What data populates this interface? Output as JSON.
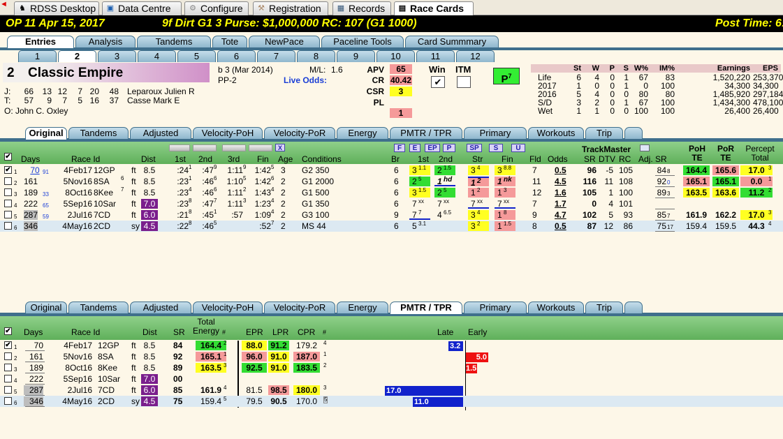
{
  "app": {
    "tabs": [
      {
        "label": "RDSS Desktop",
        "icon": "horse-icon"
      },
      {
        "label": "Data Centre",
        "icon": "folder-icon"
      },
      {
        "label": "Configure",
        "icon": "gear-icon"
      },
      {
        "label": "Registration",
        "icon": "wrench-icon"
      },
      {
        "label": "Records",
        "icon": "grid-icon"
      },
      {
        "label": "Race Cards",
        "icon": "document-icon"
      }
    ]
  },
  "race": {
    "track": "OP 11 Apr 15, 2017",
    "conditions": "9f Dirt G1 3 Purse: $1,000,000 RC: 107 (G1 1000)",
    "post": "Post Time: 6:"
  },
  "view_tabs": [
    "Entries",
    "Analysis",
    "Tandems",
    "Tote",
    "NewPace",
    "Paceline Tools",
    "Card Summmary"
  ],
  "entry_tabs": [
    "1",
    "2",
    "3",
    "4",
    "5",
    "6",
    "7",
    "8",
    "9",
    "10",
    "11",
    "12"
  ],
  "horse": {
    "number": "2",
    "name": "Classic Empire",
    "breeding": "b 3 (Mar 2014)",
    "pp": "PP-2",
    "ml_label": "M/L:",
    "ml": "1.6",
    "live_odds": "Live Odds:",
    "jockey": {
      "label": "J:",
      "stats": [
        "66",
        "13",
        "12",
        "7",
        "20",
        "48"
      ],
      "name": "Leparoux Julien R"
    },
    "trainer": {
      "label": "T:",
      "stats": [
        "57",
        "9",
        "7",
        "5",
        "16",
        "37"
      ],
      "name": "Casse Mark E"
    },
    "owner": {
      "label": "O:",
      "name": "John C. Oxley"
    }
  },
  "ratings": {
    "apv_label": "APV",
    "apv": "65",
    "cr_label": "CR",
    "cr": "40.42",
    "csr_label": "CSR",
    "csr": "3",
    "pl_label": "PL",
    "pl": "",
    "rank": "1",
    "win_label": "Win",
    "itm_label": "ITM",
    "p_badge": "P",
    "p_sup": "7"
  },
  "career": {
    "headers": [
      "St",
      "W",
      "P",
      "S",
      "W%",
      "IM%",
      "Earnings",
      "EPS"
    ],
    "rows": [
      [
        "Life",
        "6",
        "4",
        "0",
        "1",
        "67",
        "83",
        "1,520,220",
        "253,370"
      ],
      [
        "2017",
        "1",
        "0",
        "0",
        "1",
        "0",
        "100",
        "34,300",
        "34,300"
      ],
      [
        "2016",
        "5",
        "4",
        "0",
        "0",
        "80",
        "80",
        "1,485,920",
        "297,184"
      ],
      [
        "S/D",
        "3",
        "2",
        "0",
        "1",
        "67",
        "100",
        "1,434,300",
        "478,100"
      ],
      [
        "Wet",
        "1",
        "1",
        "0",
        "0",
        "100",
        "100",
        "26,400",
        "26,400"
      ]
    ]
  },
  "sub_tabs": [
    "Original",
    "Tandems",
    "Adjusted",
    "Velocity-PoH",
    "Velocity-PoR",
    "Energy",
    "PMTR / TPR",
    "Primary",
    "Workouts",
    "Trip"
  ],
  "top_table": {
    "headers": [
      "Days",
      "Race Id",
      "Dist",
      "1st",
      "2nd",
      "3rd",
      "Fin",
      "Age",
      "Conditions",
      "Br",
      "1st",
      "2nd",
      "Str",
      "Fin",
      "Fld",
      "Odds",
      "SR",
      "DTV",
      "RC",
      "Adj. SR",
      "PoH TE",
      "PoR TE",
      "Percept Total"
    ],
    "trackmaster": "TrackMaster",
    "pace_btns": [
      "F",
      "E",
      "EP",
      "P"
    ],
    "sp_btns": [
      "SP",
      "S",
      "U"
    ],
    "x_btn": "X",
    "rows": [
      {
        "n": "1",
        "checked": true,
        "days": "70",
        "ds": "7",
        "dsub": "91",
        "race": "4Feb17",
        "rs": "",
        "rt": "12GP",
        "surf": "ft",
        "dist": "8.5",
        "dc": "",
        "c1": ":24",
        "s1": "1",
        "c2": ":47",
        "s2": "9",
        "c3": "1:11",
        "s3": "9",
        "fin": "1:42",
        "s4": "5",
        "age": "3",
        "cond": "G2 350",
        "br": "6",
        "p1": "3",
        "q1": "1.1",
        "p2": "2",
        "q2": "1.5",
        "st": "3",
        "qs": "4",
        "fn": "3",
        "qf": "8.8",
        "fld": "7",
        "odds": "0.5",
        "sr": "96",
        "dtv": "-5",
        "rc": "105",
        "adj": "84",
        "as": "8",
        "poh": "164.4",
        "por": "165.6",
        "pt": "17.0",
        "ps": "3"
      },
      {
        "n": "2",
        "checked": false,
        "days": "161",
        "ds": "",
        "dsub": "",
        "race": "5Nov16",
        "rs": "6",
        "rt": "8SA",
        "surf": "ft",
        "dist": "8.5",
        "dc": "",
        "c1": ":23",
        "s1": "1",
        "c2": ":46",
        "s2": "6",
        "c3": "1:10",
        "s3": "5",
        "fin": "1:42",
        "s4": "6",
        "age": "2",
        "cond": "G1 2000",
        "br": "6",
        "p1": "2",
        "q1": "5",
        "p2": "1",
        "q2": "hd",
        "st": "1",
        "qs": "2",
        "fn": "1",
        "qf": "nk",
        "fld": "11",
        "odds": "4.5",
        "sr": "116",
        "dtv": "11",
        "rc": "108",
        "adj": "92",
        "as": "0",
        "poh": "165.1",
        "por": "165.1",
        "pt": "0.0",
        "ps": "1"
      },
      {
        "n": "3",
        "checked": false,
        "days": "189",
        "ds": "",
        "dsub": "33",
        "race": "8Oct16",
        "rs": "7",
        "rt": "8Kee",
        "surf": "ft",
        "dist": "8.5",
        "dc": "",
        "c1": ":23",
        "s1": "4",
        "c2": ":46",
        "s2": "6",
        "c3": "1:11",
        "s3": "2",
        "fin": "1:43",
        "s4": "4",
        "age": "2",
        "cond": "G1 500",
        "br": "6",
        "p1": "3",
        "q1": "1.5",
        "p2": "2",
        "q2": "5",
        "st": "1",
        "qs": "2",
        "fn": "1",
        "qf": "3",
        "fld": "12",
        "odds": "1.6",
        "sr": "105",
        "dtv": "1",
        "rc": "100",
        "adj": "89",
        "as": "3",
        "poh": "163.5",
        "por": "163.6",
        "pt": "11.2",
        "ps": "2"
      },
      {
        "n": "4",
        "checked": false,
        "days": "222",
        "ds": "",
        "dsub": "65",
        "race": "5Sep16",
        "rs": "",
        "rt": "10Sar",
        "surf": "ft",
        "dist": "7.0",
        "dc": "purple",
        "c1": ":23",
        "s1": "8",
        "c2": ":47",
        "s2": "7",
        "c3": "1:11",
        "s3": "3",
        "fin": "1:23",
        "s4": "4",
        "age": "2",
        "cond": "G1 350",
        "br": "6",
        "p1": "7",
        "q1": "xx",
        "p2": "7",
        "q2": "xx",
        "st": "7",
        "qs": "xx",
        "fn": "7",
        "qf": "xx",
        "fld": "7",
        "odds": "1.7",
        "sr": "0",
        "dtv": "4",
        "rc": "101",
        "adj": "",
        "as": "",
        "poh": "",
        "por": "",
        "pt": "",
        "ps": ""
      },
      {
        "n": "5",
        "checked": false,
        "days": "287",
        "ds": "",
        "dsub": "59",
        "race": "2Jul16",
        "rs": "",
        "rt": "7CD",
        "surf": "ft",
        "dist": "6.0",
        "dc": "purple",
        "c1": ":21",
        "s1": "8",
        "c2": ":45",
        "s2": "1",
        "c3": ":57",
        "s3": "",
        "fin": "1:09",
        "s4": "4",
        "age": "2",
        "cond": "G3 100",
        "br": "9",
        "p1": "7",
        "q1": "7",
        "p2": "4",
        "q2": "6.5",
        "st": "3",
        "qs": "4",
        "fn": "1",
        "qf": "8",
        "fld": "9",
        "odds": "4.7",
        "sr": "102",
        "dtv": "5",
        "rc": "93",
        "adj": "85",
        "as": "7",
        "poh": "161.9",
        "por": "162.2",
        "pt": "17.0",
        "ps": "3"
      },
      {
        "n": "6",
        "checked": false,
        "days": "346",
        "ds": "",
        "dsub": "",
        "race": "4May16",
        "rs": "",
        "rt": "2CD",
        "surf": "sy",
        "dist": "4.5",
        "dc": "purple",
        "c1": ":22",
        "s1": "8",
        "c2": ":46",
        "s2": "5",
        "c3": "",
        "s3": "",
        "fin": ":52",
        "s4": "7",
        "age": "2",
        "cond": "MS 44",
        "br": "6",
        "p1": "5",
        "q1": "3.1",
        "p2": "",
        "q2": "",
        "st": "3",
        "qs": "2",
        "fn": "1",
        "qf": "1.5",
        "fld": "8",
        "odds": "0.5",
        "sr": "87",
        "dtv": "12",
        "rc": "86",
        "adj": "75",
        "as": "17",
        "poh": "159.4",
        "por": "159.5",
        "pt": "44.3",
        "ps": "4"
      }
    ]
  },
  "bottom_table": {
    "headers": [
      "Days",
      "Race Id",
      "Dist",
      "SR",
      "Total Energy",
      "#",
      "EPR",
      "LPR",
      "CPR",
      "#",
      "Late",
      "Early"
    ],
    "rows": [
      {
        "n": "1",
        "checked": true,
        "days": "70",
        "race": "4Feb17",
        "rt": "12GP",
        "surf": "ft",
        "dist": "8.5",
        "sr": "84",
        "te": "164.4",
        "tes": "2",
        "epr": "88.0",
        "lpr": "91.2",
        "cpr": "179.2",
        "cs": "4",
        "late": "3.2",
        "early": ""
      },
      {
        "n": "2",
        "checked": false,
        "days": "161",
        "race": "5Nov16",
        "rt": "8SA",
        "surf": "ft",
        "dist": "8.5",
        "sr": "92",
        "te": "165.1",
        "tes": "1",
        "epr": "96.0",
        "lpr": "91.0",
        "cpr": "187.0",
        "cs": "1",
        "late": "",
        "early": "5.0"
      },
      {
        "n": "3",
        "checked": false,
        "days": "189",
        "race": "8Oct16",
        "rt": "8Kee",
        "surf": "ft",
        "dist": "8.5",
        "sr": "89",
        "te": "163.5",
        "tes": "3",
        "epr": "92.5",
        "lpr": "91.0",
        "cpr": "183.5",
        "cs": "2",
        "late": "",
        "early": "1.5"
      },
      {
        "n": "4",
        "checked": false,
        "days": "222",
        "race": "5Sep16",
        "rt": "10Sar",
        "surf": "ft",
        "dist": "7.0",
        "sr": "00",
        "te": "",
        "tes": "",
        "epr": "",
        "lpr": "",
        "cpr": "",
        "cs": "",
        "late": "",
        "early": ""
      },
      {
        "n": "5",
        "checked": false,
        "days": "287",
        "race": "2Jul16",
        "rt": "7CD",
        "surf": "ft",
        "dist": "6.0",
        "sr": "85",
        "te": "161.9",
        "tes": "4",
        "epr": "81.5",
        "lpr": "98.5",
        "cpr": "180.0",
        "cs": "3",
        "late": "17.0",
        "early": ""
      },
      {
        "n": "6",
        "checked": false,
        "days": "346",
        "race": "4May16",
        "rt": "2CD",
        "surf": "sy",
        "dist": "4.5",
        "sr": "75",
        "te": "159.4",
        "tes": "5",
        "epr": "79.5",
        "lpr": "90.5",
        "cpr": "170.0",
        "cs": "5",
        "late": "11.0",
        "early": ""
      }
    ]
  },
  "colors": {
    "green": "#33dd33",
    "yellow": "#ffff22",
    "salmon": "#f59a9a",
    "red": "#ee1111",
    "purple": "#7a1e8c",
    "blue": "#1122cc"
  }
}
